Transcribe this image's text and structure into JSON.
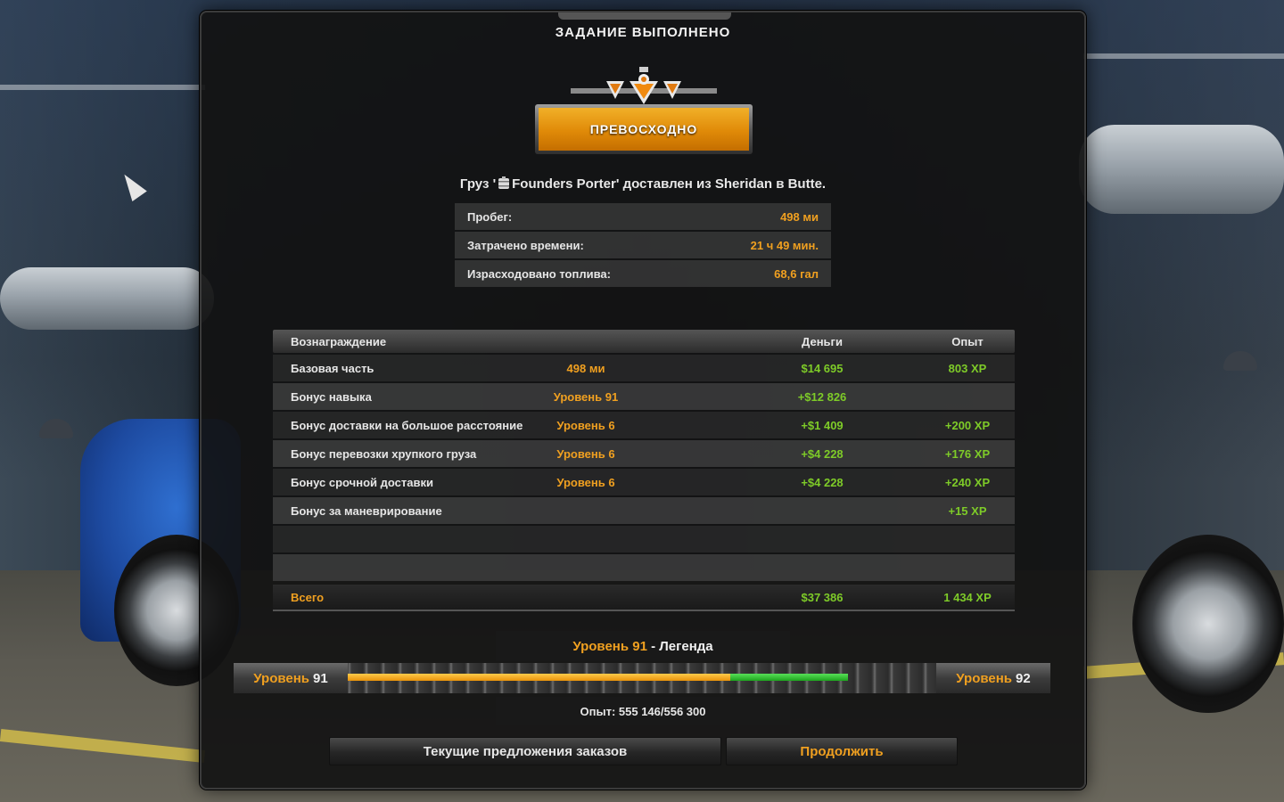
{
  "dialog": {
    "title": "ЗАДАНИЕ ВЫПОЛНЕНО",
    "rating_label": "ПРЕВОСХОДНО",
    "cargo": {
      "prefix": "Груз '",
      "cargo_name": "Founders Porter",
      "suffix": "' доставлен из Sheridan в Butte."
    }
  },
  "stats": [
    {
      "label": "Пробег:",
      "value": "498 ми"
    },
    {
      "label": "Затрачено времени:",
      "value": "21 ч 49 мин."
    },
    {
      "label": "Израсходовано топлива:",
      "value": "68,6 гал"
    }
  ],
  "rewards": {
    "headers": {
      "name": "Вознаграждение",
      "money": "Деньги",
      "xp": "Опыт"
    },
    "rows": [
      {
        "name": "Базовая часть",
        "level": "498 ми",
        "money": "$14 695",
        "xp": "803 XP"
      },
      {
        "name": "Бонус навыка",
        "level": "Уровень 91",
        "money": "+$12 826",
        "xp": ""
      },
      {
        "name": "Бонус доставки на большое расстояние",
        "level": "Уровень 6",
        "money": "+$1 409",
        "xp": "+200 XP"
      },
      {
        "name": "Бонус перевозки хрупкого груза",
        "level": "Уровень 6",
        "money": "+$4 228",
        "xp": "+176 XP"
      },
      {
        "name": "Бонус срочной доставки",
        "level": "Уровень 6",
        "money": "+$4 228",
        "xp": "+240 XP"
      },
      {
        "name": "Бонус за маневрирование",
        "level": "",
        "money": "",
        "xp": "+15 XP"
      }
    ],
    "total": {
      "name": "Всего",
      "money": "$37 386",
      "xp": "1 434 XP"
    }
  },
  "level": {
    "title_number": "Уровень 91",
    "title_rest": " - Легенда",
    "current_word": "Уровень",
    "current_num": "91",
    "next_word": "Уровень",
    "next_num": "92",
    "progress_before": 0.65,
    "progress_gained": 0.2,
    "xp_text": "Опыт: 555 146/556 300"
  },
  "buttons": {
    "offers": "Текущие предложения заказов",
    "continue": "Продолжить"
  },
  "colors": {
    "accent_orange": "#f0a020",
    "bonus_green": "#7ecb28",
    "progress_green": "#1ea41e"
  },
  "icons": {
    "cargo": "beer-keg-icon",
    "rating_emblem": "excellent-rating-emblem-icon",
    "cursor": "mouse-cursor-icon"
  }
}
